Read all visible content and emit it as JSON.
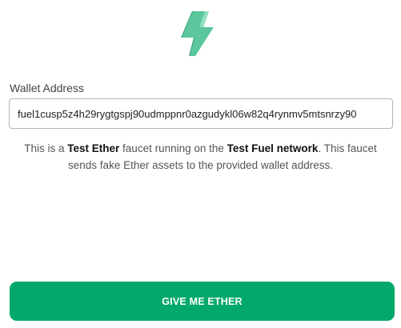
{
  "logo": {
    "icon": "lightning-bolt-icon",
    "color": "#58c49a"
  },
  "form": {
    "address_label": "Wallet Address",
    "address_value": "fuel1cusp5z4h29rygtgspj90udmppnr0azgudykl06w82q4rynmv5mtsnrzy90"
  },
  "description": {
    "part1": "This is a ",
    "strong1": "Test Ether",
    "part2": " faucet running on the ",
    "strong2": "Test Fuel network",
    "part3": ". This faucet sends fake Ether assets to the provided wallet address."
  },
  "button": {
    "label": "GIVE ME ETHER",
    "color": "#03a96b"
  }
}
